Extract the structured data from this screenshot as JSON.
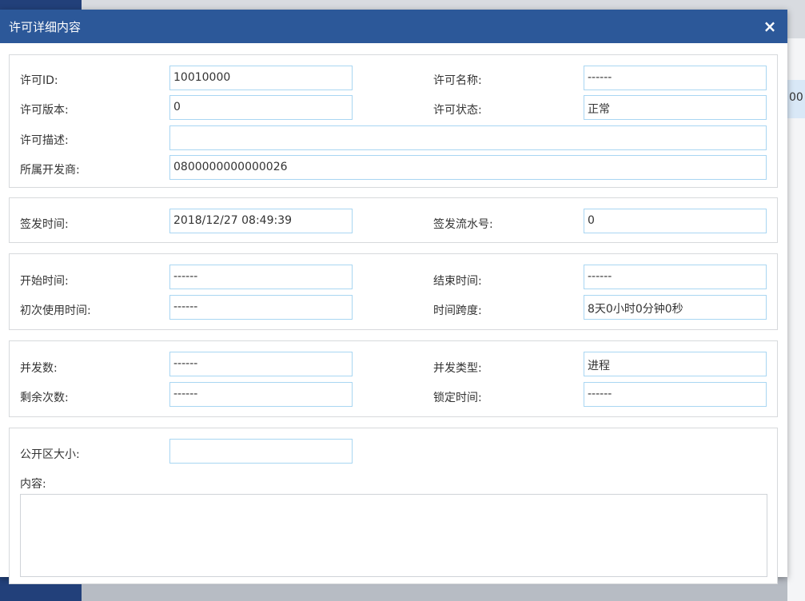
{
  "background": {
    "row_text": "00"
  },
  "modal": {
    "title": "许可详细内容",
    "close_icon": "×"
  },
  "basic": {
    "license_id_label": "许可ID:",
    "license_id_value": "10010000",
    "license_name_label": "许可名称:",
    "license_name_value": "------",
    "license_version_label": "许可版本:",
    "license_version_value": "0",
    "license_status_label": "许可状态:",
    "license_status_value": "正常",
    "license_desc_label": "许可描述:",
    "license_desc_value": "",
    "developer_label": "所属开发商:",
    "developer_value": "0800000000000026"
  },
  "issue": {
    "issue_time_label": "签发时间:",
    "issue_time_value": "2018/12/27 08:49:39",
    "issue_serial_label": "签发流水号:",
    "issue_serial_value": "0"
  },
  "time": {
    "start_label": "开始时间:",
    "start_value": "------",
    "end_label": "结束时间:",
    "end_value": "------",
    "first_use_label": "初次使用时间:",
    "first_use_value": "------",
    "span_label": "时间跨度:",
    "span_value": "8天0小时0分钟0秒"
  },
  "concurrency": {
    "count_label": "并发数:",
    "count_value": "------",
    "type_label": "并发类型:",
    "type_value": "进程",
    "remaining_label": "剩余次数:",
    "remaining_value": "------",
    "lock_label": "锁定时间:",
    "lock_value": "------"
  },
  "public": {
    "size_label": "公开区大小:",
    "size_value": "",
    "content_label": "内容:",
    "content_value": ""
  }
}
